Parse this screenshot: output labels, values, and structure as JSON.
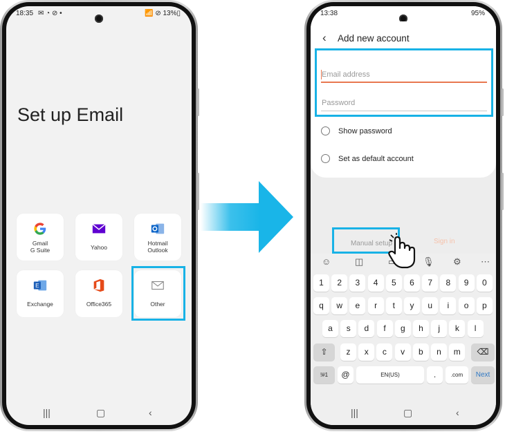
{
  "left_phone": {
    "status": {
      "time": "18:35",
      "left_icons": "✉ ◔ ⊘ •",
      "right": "📶 ⊘ 13%▯"
    },
    "title": "Set up Email",
    "accounts": [
      {
        "id": "gmail",
        "label_1": "Gmail",
        "label_2": "G Suite",
        "icon": "google-icon"
      },
      {
        "id": "yahoo",
        "label_1": "Yahoo",
        "label_2": "",
        "icon": "yahoo-envelope-icon"
      },
      {
        "id": "hotmail",
        "label_1": "Hotmail",
        "label_2": "Outlook",
        "icon": "outlook-icon"
      },
      {
        "id": "exchange",
        "label_1": "Exchange",
        "label_2": "",
        "icon": "exchange-icon"
      },
      {
        "id": "office365",
        "label_1": "Office365",
        "label_2": "",
        "icon": "office-icon"
      },
      {
        "id": "other",
        "label_1": "Other",
        "label_2": "",
        "icon": "envelope-icon"
      }
    ],
    "nav": {
      "recents": "|||",
      "home": "▢",
      "back": "‹"
    }
  },
  "right_phone": {
    "status": {
      "time": "13:38",
      "right": "95%"
    },
    "header": {
      "back": "‹",
      "title": "Add new account"
    },
    "email_field": {
      "placeholder": "Email address"
    },
    "password_field": {
      "placeholder": "Password"
    },
    "show_password": "Show password",
    "default_account": "Set as default account",
    "manual_setup": "Manual setup",
    "sign_in": "Sign in",
    "keyboard": {
      "row_numbers": [
        "1",
        "2",
        "3",
        "4",
        "5",
        "6",
        "7",
        "8",
        "9",
        "0"
      ],
      "row_1": [
        "q",
        "w",
        "e",
        "r",
        "t",
        "y",
        "u",
        "i",
        "o",
        "p"
      ],
      "row_2": [
        "a",
        "s",
        "d",
        "f",
        "g",
        "h",
        "j",
        "k",
        "l"
      ],
      "row_3": [
        "z",
        "x",
        "c",
        "v",
        "b",
        "n",
        "m"
      ],
      "sym": "!#1",
      "at": "@",
      "space": "EN(US)",
      "dot": ".",
      "dotcom": ".com",
      "next": "Next",
      "shift": "⇧",
      "backspace": "⌫"
    },
    "nav": {
      "recents": "|||",
      "home": "▢",
      "back": "‹"
    }
  },
  "colors": {
    "highlight": "#18b2e6",
    "arrow": "#19b5e8",
    "focus_line": "#e8774f"
  }
}
